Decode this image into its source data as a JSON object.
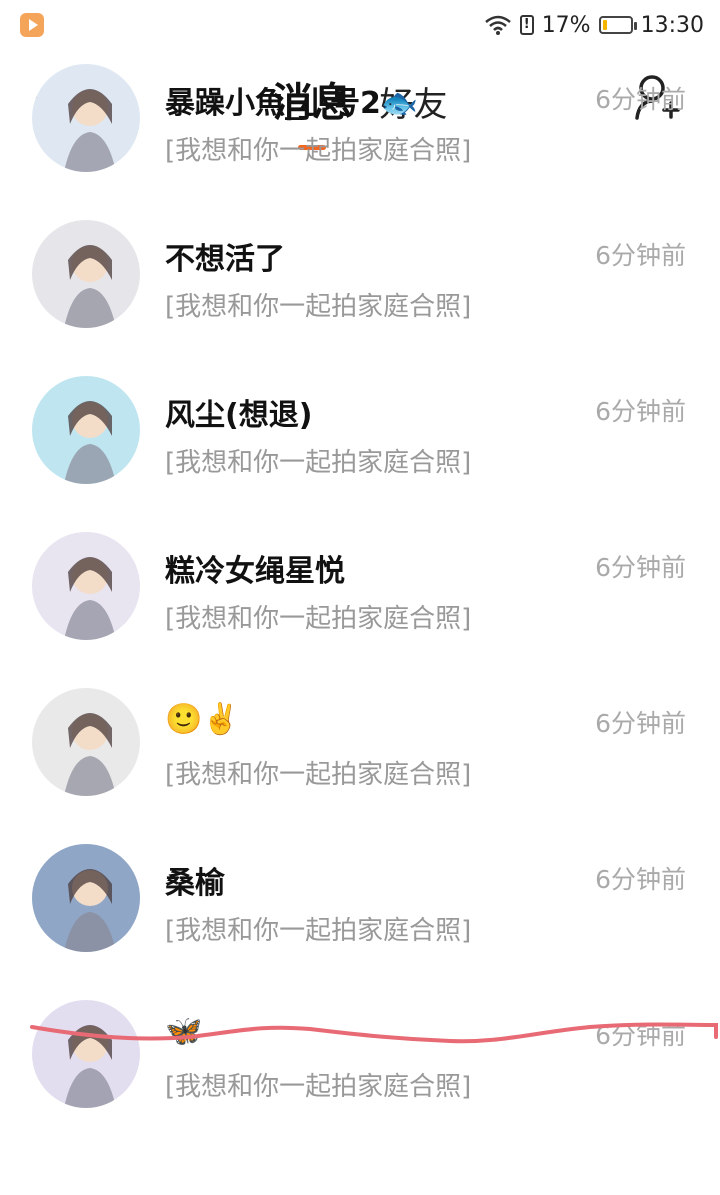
{
  "status_bar": {
    "battery_percent": "17%",
    "time": "13:30",
    "battery_level": 0.17,
    "alert_glyph": "!"
  },
  "header": {
    "tab_active": "消息",
    "tab_other": "好友"
  },
  "messages": [
    {
      "name": "暴躁小魚_小号2🐟",
      "preview": "[我想和你一起拍家庭合照]",
      "time": "6分钟前",
      "avatar_bg": "#dfe8f2"
    },
    {
      "name": "不想活了",
      "preview": "[我想和你一起拍家庭合照]",
      "time": "6分钟前",
      "avatar_bg": "#e6e6ea"
    },
    {
      "name": "风尘(想退)",
      "preview": "[我想和你一起拍家庭合照]",
      "time": "6分钟前",
      "avatar_bg": "#bfe6f0"
    },
    {
      "name": "糕冷女绳星悦",
      "preview": "[我想和你一起拍家庭合照]",
      "time": "6分钟前",
      "avatar_bg": "#e8e4f0"
    },
    {
      "name": "🙂✌️",
      "preview": "[我想和你一起拍家庭合照]",
      "time": "6分钟前",
      "avatar_bg": "#e9e9e9"
    },
    {
      "name": "桑榆",
      "preview": "[我想和你一起拍家庭合照]",
      "time": "6分钟前",
      "avatar_bg": "#8fa6c6"
    },
    {
      "name": "🦋",
      "preview": "[我想和你一起拍家庭合照]",
      "time": "6分钟前",
      "avatar_bg": "#e2def0"
    }
  ]
}
